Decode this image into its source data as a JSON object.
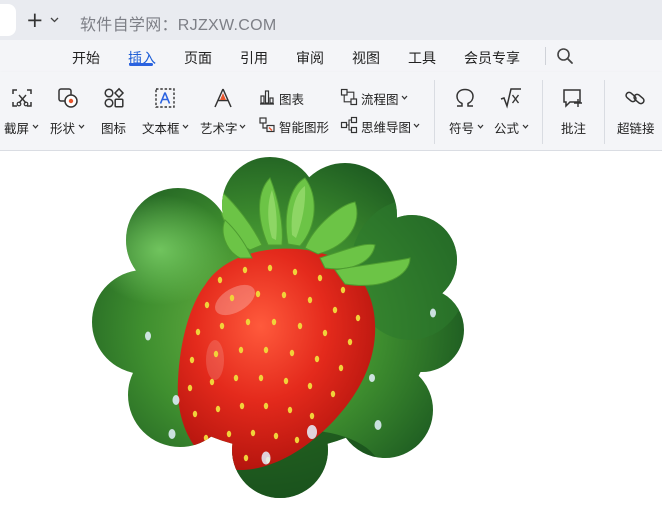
{
  "window": {
    "title": "软件自学网：RJZXW.COM"
  },
  "menu": {
    "tabs": [
      {
        "label": "开始"
      },
      {
        "label": "插入",
        "active": true
      },
      {
        "label": "页面"
      },
      {
        "label": "引用"
      },
      {
        "label": "审阅"
      },
      {
        "label": "视图"
      },
      {
        "label": "工具"
      },
      {
        "label": "会员专享"
      }
    ]
  },
  "ribbon": {
    "screenshot": "截屏",
    "shape": "形状",
    "icon": "图标",
    "textbox": "文本框",
    "wordart": "艺术字",
    "chart": "图表",
    "smartart": "智能图形",
    "flowchart": "流程图",
    "mindmap": "思维导图",
    "symbol": "符号",
    "formula": "公式",
    "comment": "批注",
    "hyperlink": "超链接"
  },
  "colors": {
    "accent": "#2a62e0",
    "title_text": "#7d7f86"
  },
  "document": {
    "image": "strawberry-cloud-shaped-picture"
  }
}
